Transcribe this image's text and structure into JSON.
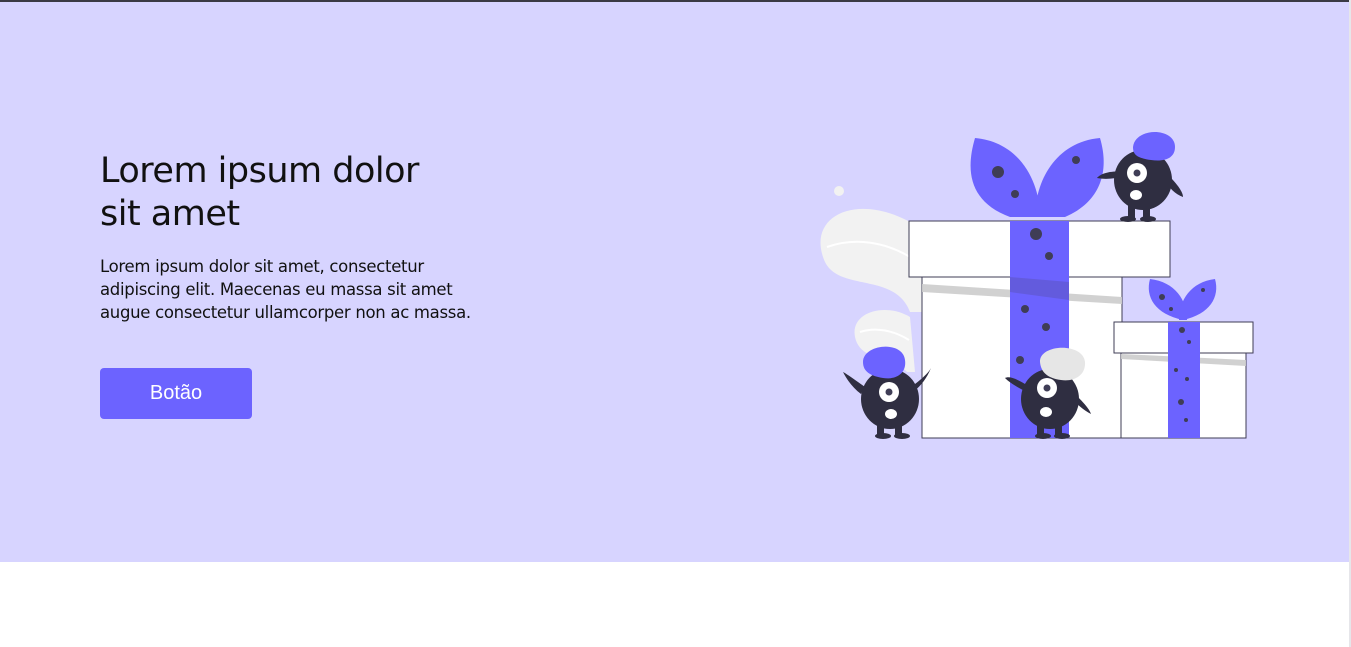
{
  "hero": {
    "title_line1": "Lorem ipsum dolor",
    "title_line2": "sit amet",
    "description": "Lorem ipsum dolor sit amet, consectetur adipiscing elit. Maecenas eu massa sit amet augue consectetur ullamcorper non ac massa.",
    "button_label": "Botão"
  },
  "colors": {
    "hero_background": "#d7d4ff",
    "accent": "#6c63ff",
    "dark": "#2f2e41"
  },
  "illustration": {
    "icon": "gift-boxes-monsters-illustration"
  }
}
